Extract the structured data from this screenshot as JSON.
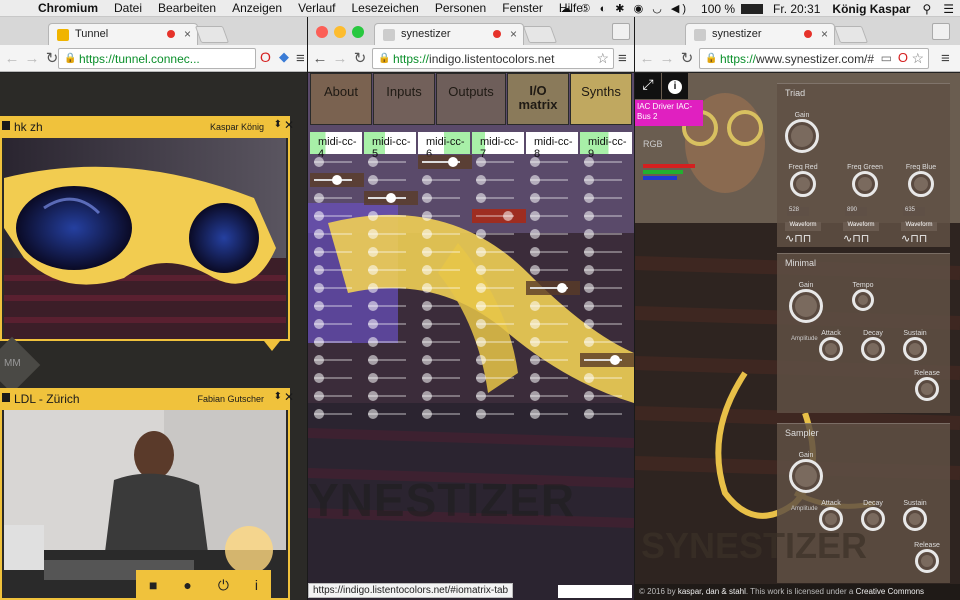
{
  "menubar": {
    "app": "Chromium",
    "items": [
      "Datei",
      "Bearbeiten",
      "Anzeigen",
      "Verlauf",
      "Lesezeichen",
      "Personen",
      "Fenster",
      "Hilfe"
    ],
    "battery": "100 %",
    "clock": "Fr. 20:31",
    "user": "König Kaspar"
  },
  "left_window": {
    "tab_title": "Tunnel",
    "url": "https://tunnel.connec...",
    "panel1": {
      "title": "hk zh",
      "user": "Kaspar König"
    },
    "mm_label": "MM",
    "panel2": {
      "title": "LDL - Zürich",
      "user": "Fabian Gutscher"
    }
  },
  "middle_window": {
    "tab_title": "synestizer",
    "url_https": "https://",
    "url_rest": "indigo.listentocolors.net",
    "nav": [
      "About",
      "Inputs",
      "Outputs",
      "I/O matrix",
      "Synths"
    ],
    "midi_columns": [
      "midi-cc-4",
      "midi-cc-5",
      "midi-cc-6",
      "midi-cc-7",
      "midi-cc-8",
      "midi-cc-9"
    ],
    "watermark": "YNESTIZER",
    "status_url": "https://indigo.listentocolors.net/#iomatrix-tab"
  },
  "right_window": {
    "tab_title": "synestizer",
    "url_https": "https://",
    "url_rest": "www.synestizer.com/#",
    "iac_label": "IAC Driver IAC-Bus 2",
    "rgb_label": "RGB",
    "rgb_colors": [
      "#d42020",
      "#22b030",
      "#2038d0"
    ],
    "triad": {
      "title": "Triad",
      "gain": "Gain",
      "freq_red": "Freq Red",
      "freq_green": "Freq Green",
      "freq_blue": "Freq Blue",
      "val_red": "528",
      "val_green": "890",
      "val_blue": "635",
      "waveform": "Waveform"
    },
    "minimal": {
      "title": "Minimal",
      "gain": "Gain",
      "tempo": "Tempo",
      "amplitude": "Amplitude",
      "attack": "Attack",
      "decay": "Decay",
      "sustain": "Sustain",
      "release": "Release"
    },
    "sampler": {
      "title": "Sampler",
      "gain": "Gain",
      "amplitude": "Amplitude",
      "attack": "Attack",
      "decay": "Decay",
      "sustain": "Sustain",
      "release": "Release"
    },
    "watermark": "SYNESTIZER",
    "footer_prefix": "© 2016 by",
    "footer_names": "kaspar, dan & stahl",
    "footer_mid": ". This work is licensed under a",
    "footer_link": "Creative Commons"
  }
}
